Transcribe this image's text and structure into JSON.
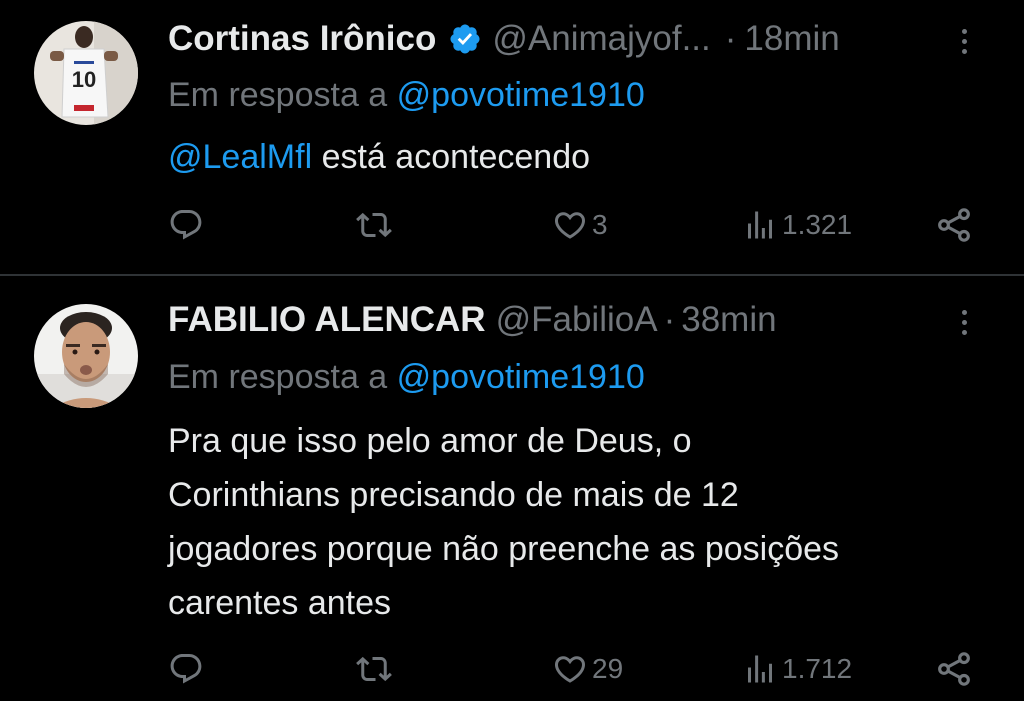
{
  "tweets": [
    {
      "display_name": "Cortinas Irônico",
      "verified": true,
      "handle": "@Animajyof...",
      "time": "18min",
      "reply_prefix": "Em resposta a",
      "reply_to": "@povotime1910",
      "body_mention": "@LealMfl",
      "body_lines": [
        "está acontecendo"
      ],
      "likes": "3",
      "views": "1.321"
    },
    {
      "display_name": "FABILIO ALENCAR",
      "verified": false,
      "handle": "@FabilioA",
      "time": "38min",
      "reply_prefix": "Em resposta a",
      "reply_to": "@povotime1910",
      "body_lines": [
        "Pra que isso pelo amor de Deus, o",
        "Corinthians precisando de mais de 12",
        "jogadores porque não preenche as posições",
        "carentes antes"
      ],
      "likes": "29",
      "views": "1.712"
    }
  ],
  "separator": "·",
  "icons": {
    "verified": "verified-badge-icon",
    "more": "more-options-icon",
    "reply": "reply-icon",
    "retweet": "retweet-icon",
    "like": "heart-icon",
    "views": "views-icon",
    "share": "share-icon"
  },
  "colors": {
    "background": "#000000",
    "text": "#e7e9ea",
    "muted": "#71767b",
    "link": "#1d9bf0",
    "divider": "#2f3336"
  }
}
